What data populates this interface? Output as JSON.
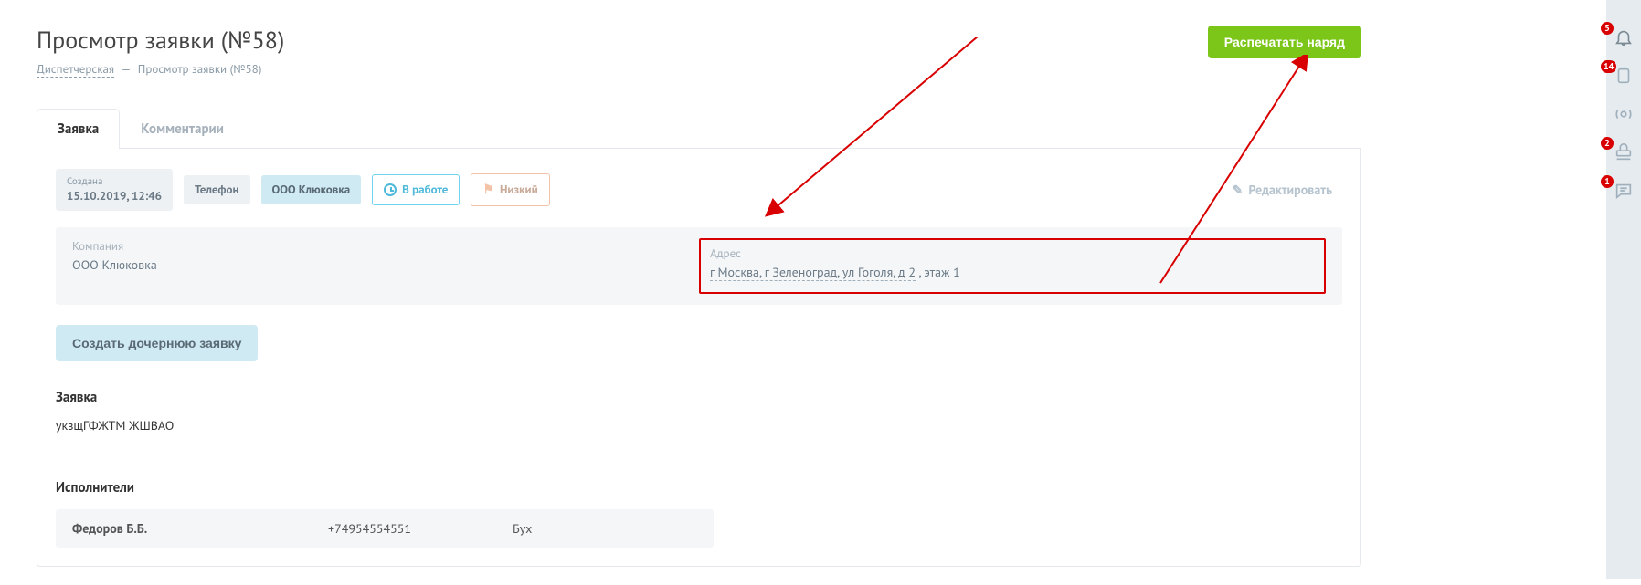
{
  "header": {
    "title": "Просмотр заявки (№58)",
    "print_label": "Распечатать наряд"
  },
  "breadcrumb": {
    "root": "Диспетчерская",
    "current": "Просмотр заявки (№58)",
    "sep": "—"
  },
  "tabs": {
    "request": "Заявка",
    "comments": "Комментарии"
  },
  "chips": {
    "created_label": "Создана",
    "created_value": "15.10.2019, 12:46",
    "channel": "Телефон",
    "company": "ООО Клюковка",
    "status": "В работе",
    "priority": "Низкий",
    "edit": "Редактировать"
  },
  "info": {
    "company_label": "Компания",
    "company_value": "ООО Клюковка",
    "address_label": "Адрес",
    "address_link": "г Москва, г Зеленоград, ул Гоголя, д 2",
    "address_suffix": " , этаж 1"
  },
  "actions": {
    "child_request": "Создать дочернюю заявку"
  },
  "request": {
    "section_title": "Заявка",
    "description": "укзщГФЖТМ ЖШВАО"
  },
  "executors": {
    "section_title": "Исполнители",
    "rows": [
      {
        "name": "Федоров Б.Б.",
        "phone": "+74954554551",
        "role": "Бух"
      }
    ]
  },
  "sidebar": {
    "items": [
      {
        "name": "bell-icon",
        "badge": "5"
      },
      {
        "name": "clipboard-icon",
        "badge": "14"
      },
      {
        "name": "broadcast-icon",
        "badge": ""
      },
      {
        "name": "stamp-icon",
        "badge": "2"
      },
      {
        "name": "chat-icon",
        "badge": "1"
      }
    ]
  }
}
